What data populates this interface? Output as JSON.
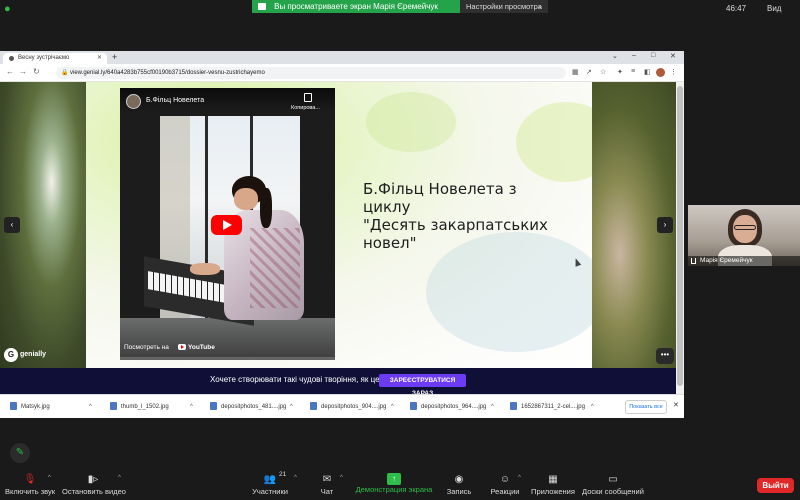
{
  "zoom": {
    "share_banner": "Вы просматриваете экран Марія Єремейчук",
    "view_options": "Настройки просмотра",
    "timer": "46:47",
    "view_label": "Вид"
  },
  "browser": {
    "tab_title": "Весну зустрічаємо",
    "url": "view.genial.ly/640a4283b755cf00190b3715/dossier-vesnu-zustrichayemo"
  },
  "video": {
    "title": "Б.Фільц Новелета",
    "copy_label": "Копирова...",
    "watch_on": "Посмотреть на",
    "youtube": "YouTube"
  },
  "slide": {
    "title": "Б.Фільц Новелета з циклу\n\"Десять закарпатських\nновел\""
  },
  "genially": {
    "logo_letter": "G",
    "brand": "genially"
  },
  "cta": {
    "text": "Хочете створювати такі чудові творіння, як це?",
    "button": "ЗАРЕЄСТРУВАТИСЯ ЗАРАЗ"
  },
  "downloads": {
    "items": [
      "Matsyk.jpg",
      "thumb_l_1502.jpg",
      "depositphotos_481....jpg",
      "depositphotos_904....jpg",
      "depositphotos_964....jpg",
      "1652867311_2-cel....jpg"
    ],
    "show_all": "Показать все"
  },
  "participant": {
    "name": "Марія Єремейчук"
  },
  "toolbar": {
    "mute": "Включить звук",
    "stop_video": "Остановить видео",
    "participants": "Участники",
    "participants_count": "21",
    "chat": "Чат",
    "share": "Демонстрация экрана",
    "record": "Запись",
    "reactions": "Реакции",
    "apps": "Приложения",
    "whiteboards": "Доски сообщений",
    "leave": "Выйти"
  },
  "colors": {
    "zoom_green": "#24a34a",
    "cta_bg": "#100f38",
    "cta_button": "#6c3cf5",
    "leave_red": "#e02828"
  }
}
